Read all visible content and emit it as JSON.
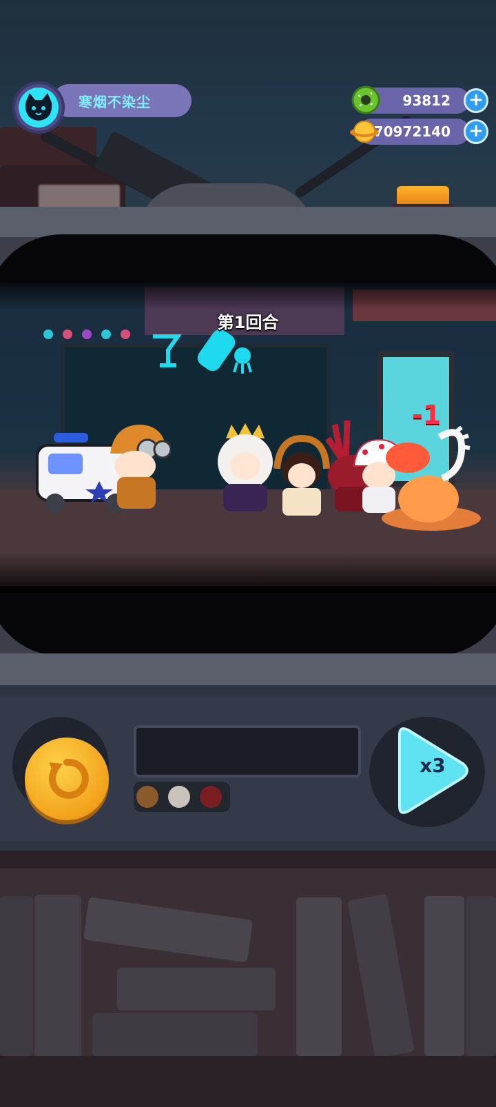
{
  "player": {
    "name": "寒烟不染尘",
    "avatar_icon": "cat-face-icon"
  },
  "currencies": [
    {
      "name": "donut",
      "icon": "green-donut-icon",
      "value": "93812",
      "add_icon": "plus-icon"
    },
    {
      "name": "planet-coin",
      "icon": "planet-coin-icon",
      "value": "70972140",
      "add_icon": "plus-icon"
    }
  ],
  "battle": {
    "round_label": "第1回合",
    "damage_popup": "-1"
  },
  "controls": {
    "restart_icon": "restart-icon",
    "speed_label": "x3",
    "speed_icon": "play-icon",
    "indicator_dots": [
      "#8a5a2c",
      "#c9c3bc",
      "#7a1e24"
    ]
  },
  "colors": {
    "accent_cyan": "#5ff0ff",
    "gold": "#f2a21b",
    "damage_red": "#ff2d43",
    "plus_blue": "#2f9cf0"
  }
}
